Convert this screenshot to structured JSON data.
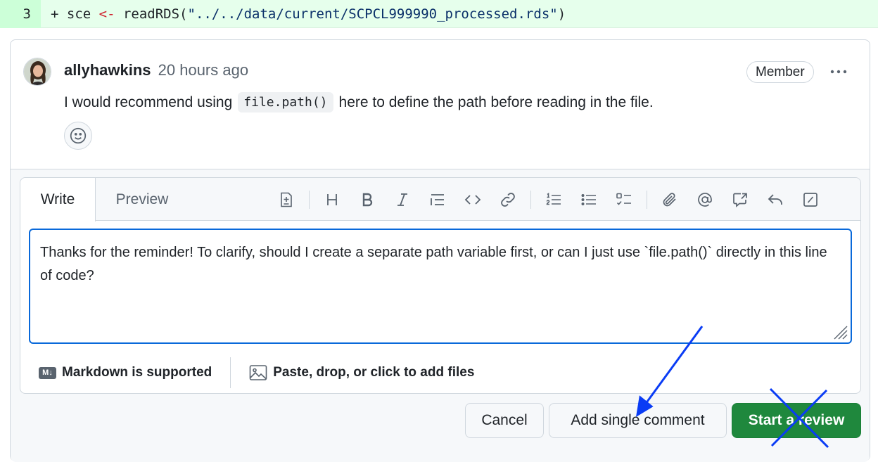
{
  "diff": {
    "line_number": "3",
    "plus": "+ ",
    "code_prefix": "sce ",
    "operator": "<-",
    "function": " readRDS(",
    "string": "\"../../data/current/SCPCL999990_processed.rds\"",
    "close": ")"
  },
  "comment": {
    "author": "allyhawkins",
    "time": "20 hours ago",
    "badge": "Member",
    "body_before": "I would recommend using",
    "inline_code": "file.path()",
    "body_after": "here to define the path before reading in the file."
  },
  "editor": {
    "tab_write": "Write",
    "tab_preview": "Preview",
    "toolbar_icons": [
      "add-file-icon",
      "heading-icon",
      "bold-icon",
      "italic-icon",
      "quote-icon",
      "code-icon",
      "link-icon",
      "ordered-list-icon",
      "unordered-list-icon",
      "task-list-icon",
      "attach-icon",
      "mention-icon",
      "reference-icon",
      "reply-icon",
      "slash-icon"
    ],
    "text": "Thanks for the reminder! To clarify, should I create a separate path variable first, or can I just use `file.path()` directly in this line of code?",
    "markdown_label": "Markdown is supported",
    "markdown_badge": "M↓",
    "attach_label": "Paste, drop, or click to add files"
  },
  "buttons": {
    "cancel": "Cancel",
    "add_single": "Add single comment",
    "start_review": "Start a review"
  },
  "colors": {
    "accent": "#0969da",
    "primary_button": "#1f883d",
    "annotation": "#0a3cf5"
  }
}
